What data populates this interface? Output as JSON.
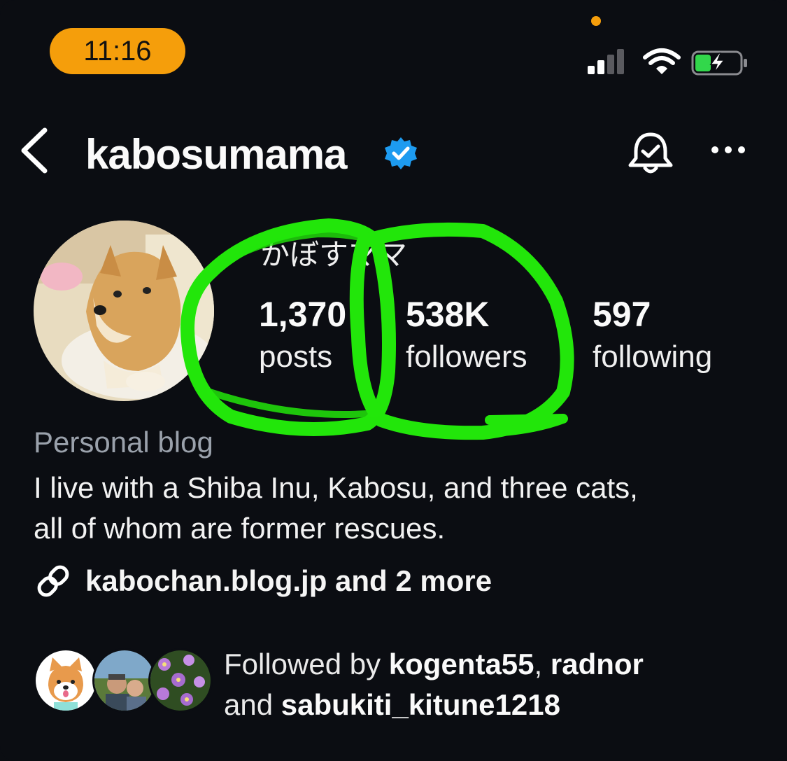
{
  "status_bar": {
    "time": "11:16",
    "icons": [
      "signal-icon",
      "wifi-icon",
      "battery-charging-icon"
    ],
    "accent": "#f59e0b"
  },
  "header": {
    "username": "kabosumama",
    "verified": true,
    "icons": [
      "back-chevron-icon",
      "verified-badge-icon",
      "notification-bell-icon",
      "more-options-icon"
    ]
  },
  "profile": {
    "display_name": "かぼすママ",
    "stats": {
      "posts_value": "1,370",
      "posts_label": "posts",
      "followers_value": "538K",
      "followers_label": "followers",
      "following_value": "597",
      "following_label": "following"
    },
    "category": "Personal blog",
    "bio_line1": "I live with a Shiba Inu, Kabosu, and three cats,",
    "bio_line2": "all of whom are former rescues.",
    "link_text": "kabochan.blog.jp and 2 more"
  },
  "followed_by": {
    "prefix": "Followed by ",
    "user1": "kogenta55",
    "sep": ", ",
    "user2": "radnor",
    "mid": "and ",
    "user3": "sabukiti_kitune1218"
  },
  "colors": {
    "background": "#0b0d12",
    "verified": "#1d9bf0",
    "scribble": "#22e60a",
    "muted": "#9aa1ab"
  }
}
